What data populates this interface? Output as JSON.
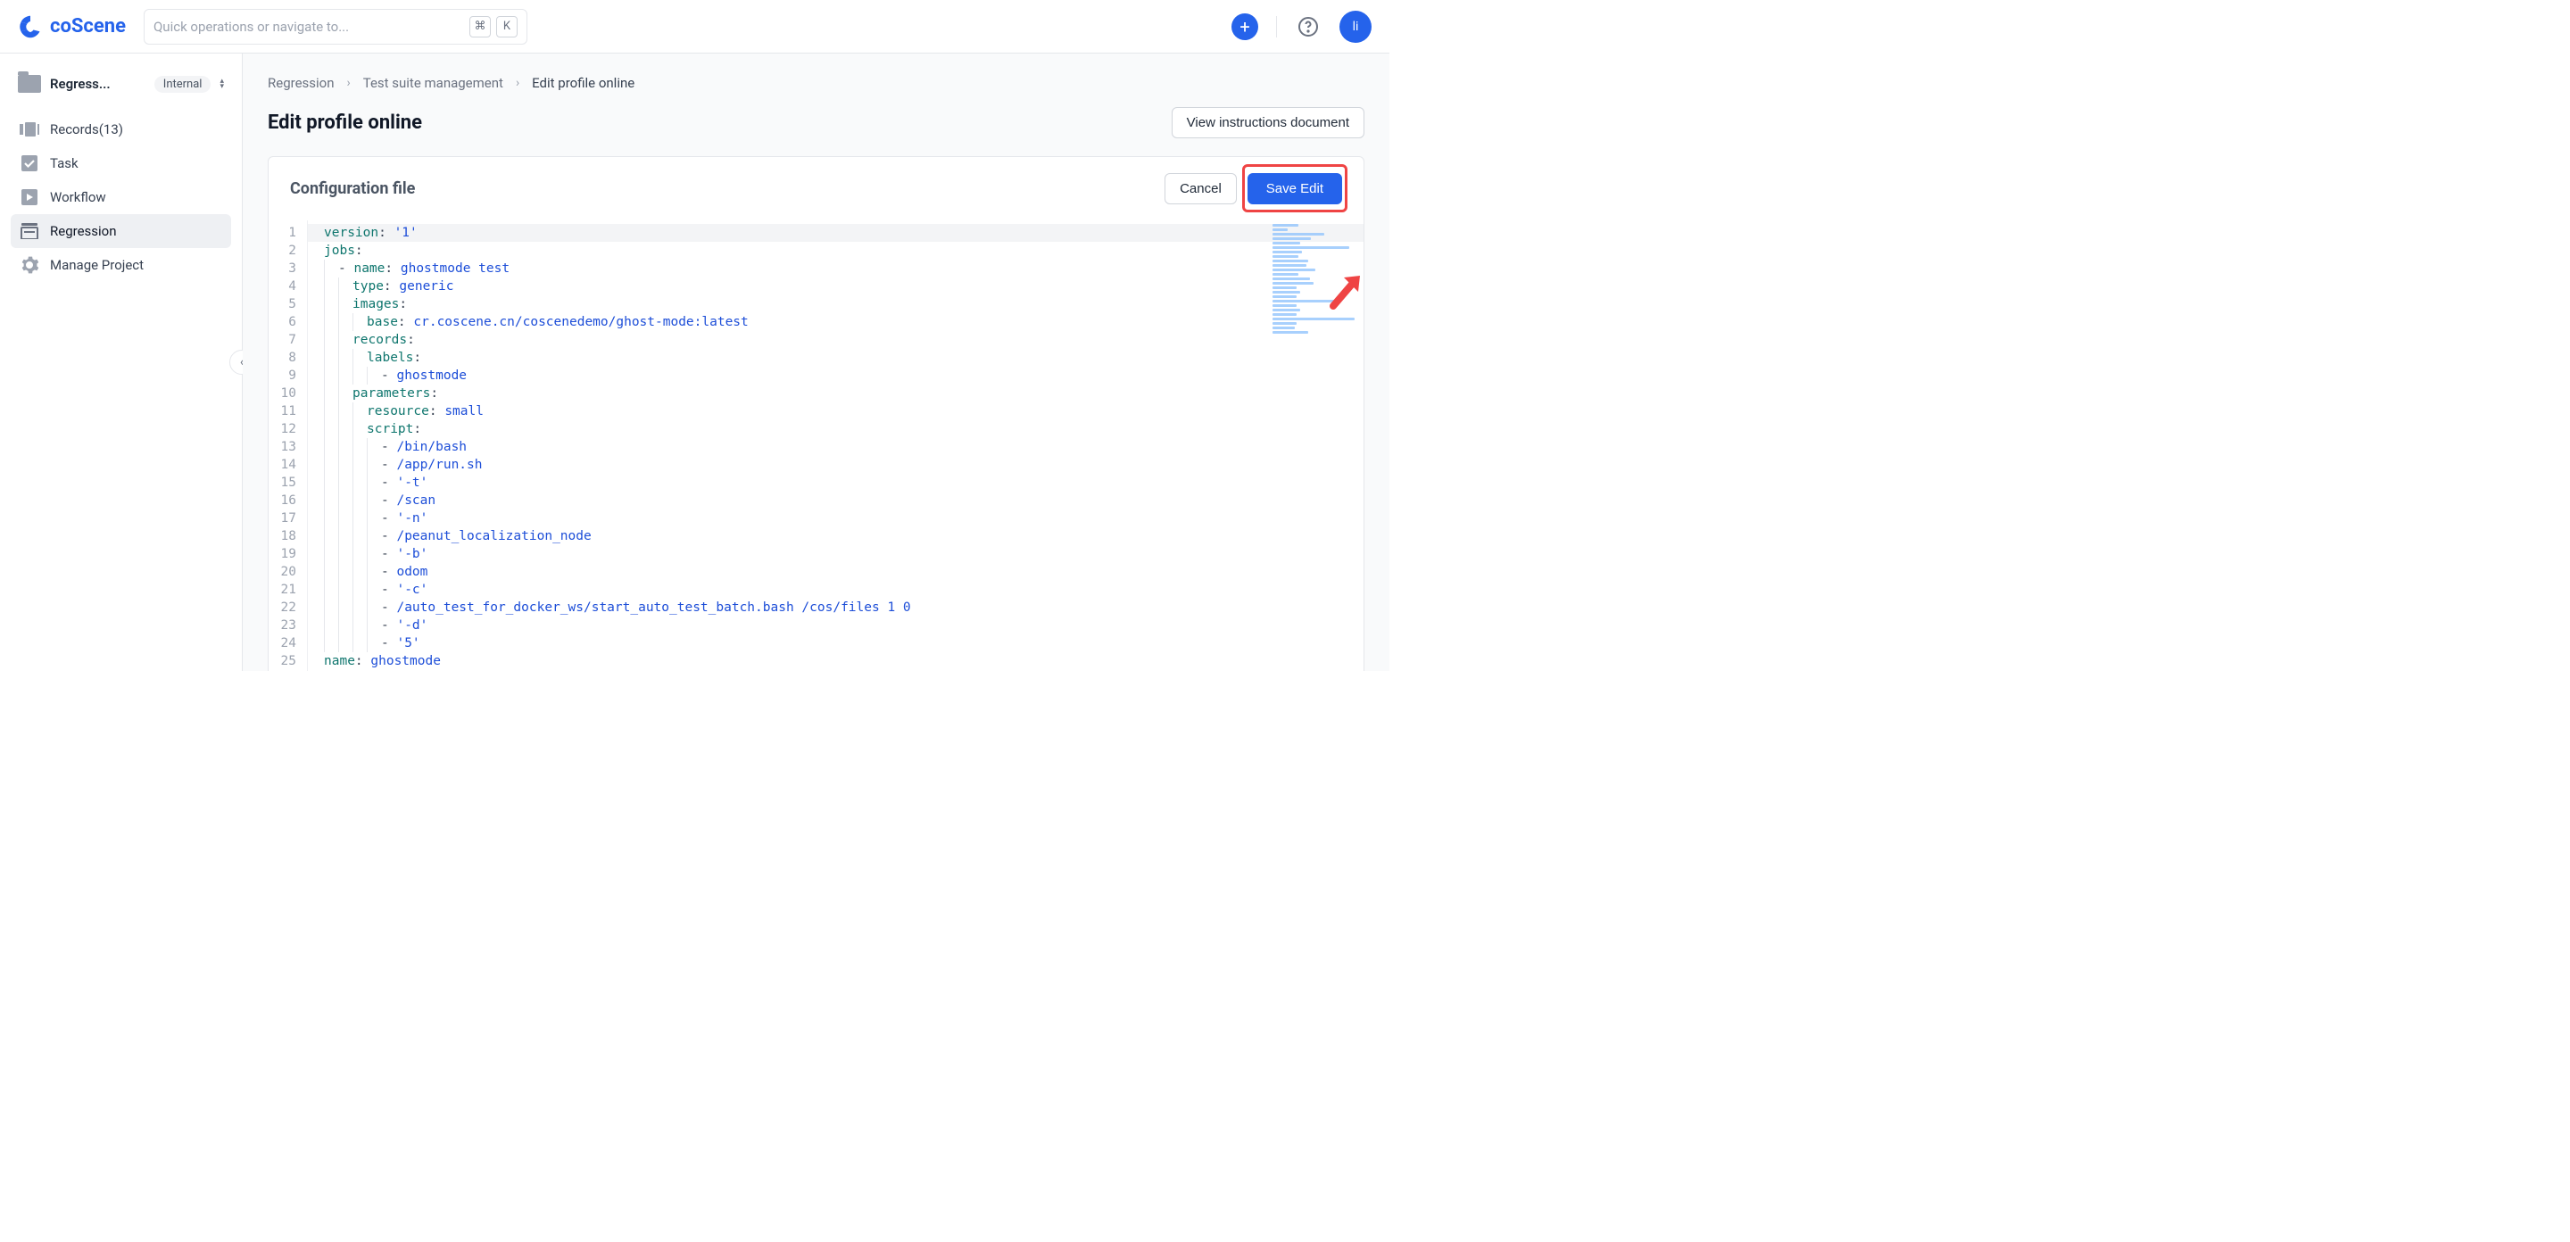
{
  "header": {
    "brand": "coScene",
    "search_placeholder": "Quick operations or navigate to...",
    "kbd_cmd": "⌘",
    "kbd_k": "K",
    "avatar_initial": "li"
  },
  "sidebar": {
    "project_name": "Regress...",
    "project_badge": "Internal",
    "items": [
      {
        "label": "Records(13)",
        "icon": "records"
      },
      {
        "label": "Task",
        "icon": "task"
      },
      {
        "label": "Workflow",
        "icon": "workflow"
      },
      {
        "label": "Regression",
        "icon": "regression"
      },
      {
        "label": "Manage Project",
        "icon": "settings"
      }
    ],
    "active_index": 3
  },
  "breadcrumb": {
    "items": [
      "Regression",
      "Test suite management",
      "Edit profile online"
    ]
  },
  "page": {
    "title": "Edit profile online",
    "instructions_btn": "View instructions document"
  },
  "panel": {
    "title": "Configuration file",
    "cancel": "Cancel",
    "save": "Save Edit"
  },
  "editor": {
    "lines": [
      {
        "indent": 0,
        "seg": [
          [
            "key",
            "version"
          ],
          [
            "punc",
            ":"
          ],
          [
            "space",
            " "
          ],
          [
            "str",
            "'1'"
          ]
        ],
        "hl": true
      },
      {
        "indent": 0,
        "seg": [
          [
            "key",
            "jobs"
          ],
          [
            "punc",
            ":"
          ]
        ]
      },
      {
        "indent": 1,
        "seg": [
          [
            "dash",
            "- "
          ],
          [
            "key",
            "name"
          ],
          [
            "punc",
            ":"
          ],
          [
            "space",
            " "
          ],
          [
            "str",
            "ghostmode test"
          ]
        ]
      },
      {
        "indent": 2,
        "seg": [
          [
            "key",
            "type"
          ],
          [
            "punc",
            ":"
          ],
          [
            "space",
            " "
          ],
          [
            "str",
            "generic"
          ]
        ]
      },
      {
        "indent": 2,
        "seg": [
          [
            "key",
            "images"
          ],
          [
            "punc",
            ":"
          ]
        ]
      },
      {
        "indent": 3,
        "seg": [
          [
            "key",
            "base"
          ],
          [
            "punc",
            ":"
          ],
          [
            "space",
            " "
          ],
          [
            "str",
            "cr.coscene.cn/coscenedemo/ghost-mode:latest"
          ]
        ]
      },
      {
        "indent": 2,
        "seg": [
          [
            "key",
            "records"
          ],
          [
            "punc",
            ":"
          ]
        ]
      },
      {
        "indent": 3,
        "seg": [
          [
            "key",
            "labels"
          ],
          [
            "punc",
            ":"
          ]
        ]
      },
      {
        "indent": 4,
        "seg": [
          [
            "dash",
            "- "
          ],
          [
            "str",
            "ghostmode"
          ]
        ]
      },
      {
        "indent": 2,
        "seg": [
          [
            "key",
            "parameters"
          ],
          [
            "punc",
            ":"
          ]
        ]
      },
      {
        "indent": 3,
        "seg": [
          [
            "key",
            "resource"
          ],
          [
            "punc",
            ":"
          ],
          [
            "space",
            " "
          ],
          [
            "str",
            "small"
          ]
        ]
      },
      {
        "indent": 3,
        "seg": [
          [
            "key",
            "script"
          ],
          [
            "punc",
            ":"
          ]
        ]
      },
      {
        "indent": 4,
        "seg": [
          [
            "dash",
            "- "
          ],
          [
            "str",
            "/bin/bash"
          ]
        ]
      },
      {
        "indent": 4,
        "seg": [
          [
            "dash",
            "- "
          ],
          [
            "str",
            "/app/run.sh"
          ]
        ]
      },
      {
        "indent": 4,
        "seg": [
          [
            "dash",
            "- "
          ],
          [
            "str",
            "'-t'"
          ]
        ]
      },
      {
        "indent": 4,
        "seg": [
          [
            "dash",
            "- "
          ],
          [
            "str",
            "/scan"
          ]
        ]
      },
      {
        "indent": 4,
        "seg": [
          [
            "dash",
            "- "
          ],
          [
            "str",
            "'-n'"
          ]
        ]
      },
      {
        "indent": 4,
        "seg": [
          [
            "dash",
            "- "
          ],
          [
            "str",
            "/peanut_localization_node"
          ]
        ]
      },
      {
        "indent": 4,
        "seg": [
          [
            "dash",
            "- "
          ],
          [
            "str",
            "'-b'"
          ]
        ]
      },
      {
        "indent": 4,
        "seg": [
          [
            "dash",
            "- "
          ],
          [
            "str",
            "odom"
          ]
        ]
      },
      {
        "indent": 4,
        "seg": [
          [
            "dash",
            "- "
          ],
          [
            "str",
            "'-c'"
          ]
        ]
      },
      {
        "indent": 4,
        "seg": [
          [
            "dash",
            "- "
          ],
          [
            "str",
            "/auto_test_for_docker_ws/start_auto_test_batch.bash /cos/files 1 0"
          ]
        ]
      },
      {
        "indent": 4,
        "seg": [
          [
            "dash",
            "- "
          ],
          [
            "str",
            "'-d'"
          ]
        ]
      },
      {
        "indent": 4,
        "seg": [
          [
            "dash",
            "- "
          ],
          [
            "str",
            "'5'"
          ]
        ]
      },
      {
        "indent": 0,
        "seg": [
          [
            "key",
            "name"
          ],
          [
            "punc",
            ":"
          ],
          [
            "space",
            " "
          ],
          [
            "str",
            "ghostmode"
          ]
        ]
      }
    ]
  }
}
